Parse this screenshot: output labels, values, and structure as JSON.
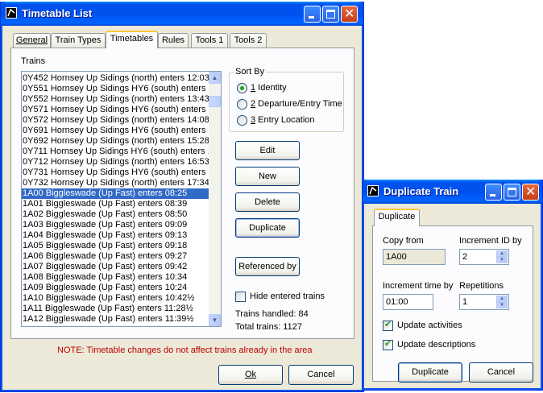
{
  "main_window": {
    "title": "Timetable List",
    "tabs": [
      {
        "label": "General"
      },
      {
        "label": "Train Types"
      },
      {
        "label": "Timetables"
      },
      {
        "label": "Rules"
      },
      {
        "label": "Tools 1"
      },
      {
        "label": "Tools 2"
      }
    ],
    "active_tab": "Timetables",
    "trains_label": "Trains",
    "trains": [
      "0Y452 Hornsey Up Sidings (north) enters 12:03",
      "0Y551 Hornsey Up Sidings HY6 (south) enters 13:",
      "0Y552 Hornsey Up Sidings (north) enters 13:43",
      "0Y571 Hornsey Up Sidings HY6 (south) enters 14:",
      "0Y572 Hornsey Up Sidings (north) enters 14:08",
      "0Y691 Hornsey Up Sidings HY6 (south) enters 15",
      "0Y692 Hornsey Up Sidings (north) enters 15:28",
      "0Y711 Hornsey Up Sidings HY6 (south) enters 16",
      "0Y712 Hornsey Up Sidings (north) enters 16:53",
      "0Y731 Hornsey Up Sidings HY6 (south) enters 17",
      "0Y732 Hornsey Up Sidings (north) enters 17:34",
      "1A00 Biggleswade (Up Fast) enters 08:25",
      "1A01 Biggleswade (Up Fast) enters 08:39",
      "1A02 Biggleswade (Up Fast) enters 08:50",
      "1A03 Biggleswade (Up Fast) enters 09:09",
      "1A04 Biggleswade (Up Fast) enters 09:13",
      "1A05 Biggleswade (Up Fast) enters 09:18",
      "1A06 Biggleswade (Up Fast) enters 09:27",
      "1A07 Biggleswade (Up Fast) enters 09:42",
      "1A08 Biggleswade (Up Fast) enters 10:34",
      "1A09 Biggleswade (Up Fast) enters 10:24",
      "1A10 Biggleswade (Up Fast) enters 10:42½",
      "1A11 Biggleswade (Up Fast) enters 11:28½",
      "1A12 Biggleswade (Up Fast) enters 11:39½"
    ],
    "selected_train": "1A00 Biggleswade (Up Fast) enters 08:25",
    "sort_by": {
      "legend": "Sort By",
      "options": [
        {
          "num": "1",
          "text": " Identity",
          "selected": true
        },
        {
          "num": "2",
          "text": " Departure/Entry Time",
          "selected": false
        },
        {
          "num": "3",
          "text": " Entry Location",
          "selected": false
        }
      ]
    },
    "buttons": {
      "edit": "Edit",
      "new": "New",
      "delete": "Delete",
      "duplicate": "Duplicate",
      "referenced_by": "Referenced by"
    },
    "hide_entered_label": "Hide entered trains",
    "hide_entered_checked": false,
    "trains_handled": "Trains handled: 84",
    "total_trains": "Total trains: 1127",
    "note": "NOTE: Timetable changes do not affect trains already in the area",
    "note_color": "#c00000",
    "ok_label": "Ok",
    "cancel_label": "Cancel",
    "selection_color": "#316ac5"
  },
  "duplicate_window": {
    "title": "Duplicate Train",
    "tab": "Duplicate",
    "copy_from_label": "Copy from",
    "copy_from_value": "1A00",
    "increment_id_label": "Increment ID by",
    "increment_id_value": "2",
    "increment_time_label": "Increment time by",
    "increment_time_value": "01:00",
    "repetitions_label": "Repetitions",
    "repetitions_value": "1",
    "update_activities_label": "Update activities",
    "update_activities_checked": true,
    "update_descriptions_label": "Update descriptions",
    "update_descriptions_checked": true,
    "duplicate_button": "Duplicate",
    "cancel_button": "Cancel"
  }
}
